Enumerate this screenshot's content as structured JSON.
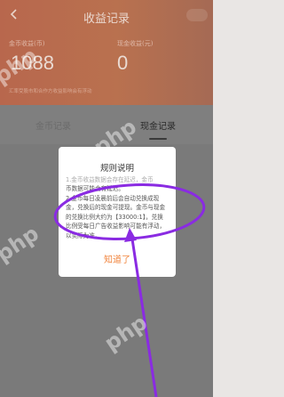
{
  "header": {
    "title": "收益记录",
    "coin_label": "金币收益(币)",
    "coin_value": "1088",
    "cash_label": "现金收益(元)",
    "cash_value": "0",
    "note": "汇率受股市和合作方收益影响会有浮动"
  },
  "tabs": [
    {
      "label": "金币记录"
    },
    {
      "label": "现金记录"
    }
  ],
  "modal": {
    "title": "规则说明",
    "faded_line": "1.金币收益数据会存在延迟，金币",
    "lines": [
      "币数据可能会有延迟。",
      "2.金币每日凌晨前后会自动兑换成现",
      "金，兑换后的现金可提现。金币与现金",
      "的兑换比例大约为【33000:1】，兑换",
      "比例受每日广告收益影响可能有浮动，",
      "以实际为准。"
    ],
    "confirm_label": "知道了"
  },
  "watermarks": [
    "php",
    "php",
    "php",
    "php"
  ],
  "colors": {
    "header": "#b9714f",
    "accent": "#f1853e",
    "annotation": "#8a2be2"
  }
}
